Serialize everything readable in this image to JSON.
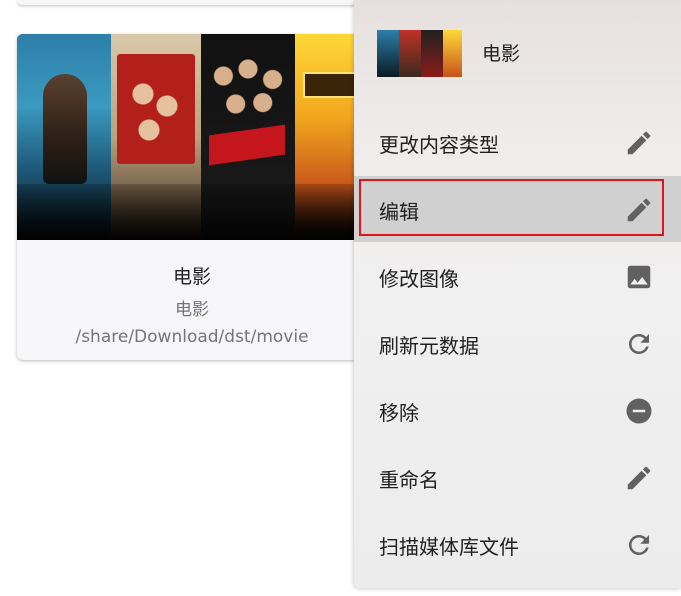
{
  "library_card": {
    "title": "电影",
    "subtitle": "电影",
    "path": "/share/Download/dst/movie"
  },
  "context_menu": {
    "header_title": "电影",
    "items": [
      {
        "label": "更改内容类型",
        "icon": "pencil-icon"
      },
      {
        "label": "编辑",
        "icon": "pencil-icon",
        "highlighted": true
      },
      {
        "label": "修改图像",
        "icon": "image-icon"
      },
      {
        "label": "刷新元数据",
        "icon": "refresh-icon"
      },
      {
        "label": "移除",
        "icon": "remove-circle-icon"
      },
      {
        "label": "重命名",
        "icon": "pencil-icon"
      },
      {
        "label": "扫描媒体库文件",
        "icon": "refresh-icon"
      }
    ]
  },
  "colors": {
    "highlight_border": "#e0161b",
    "icon": "#616161",
    "text_primary": "#202020",
    "text_secondary": "#757575"
  }
}
